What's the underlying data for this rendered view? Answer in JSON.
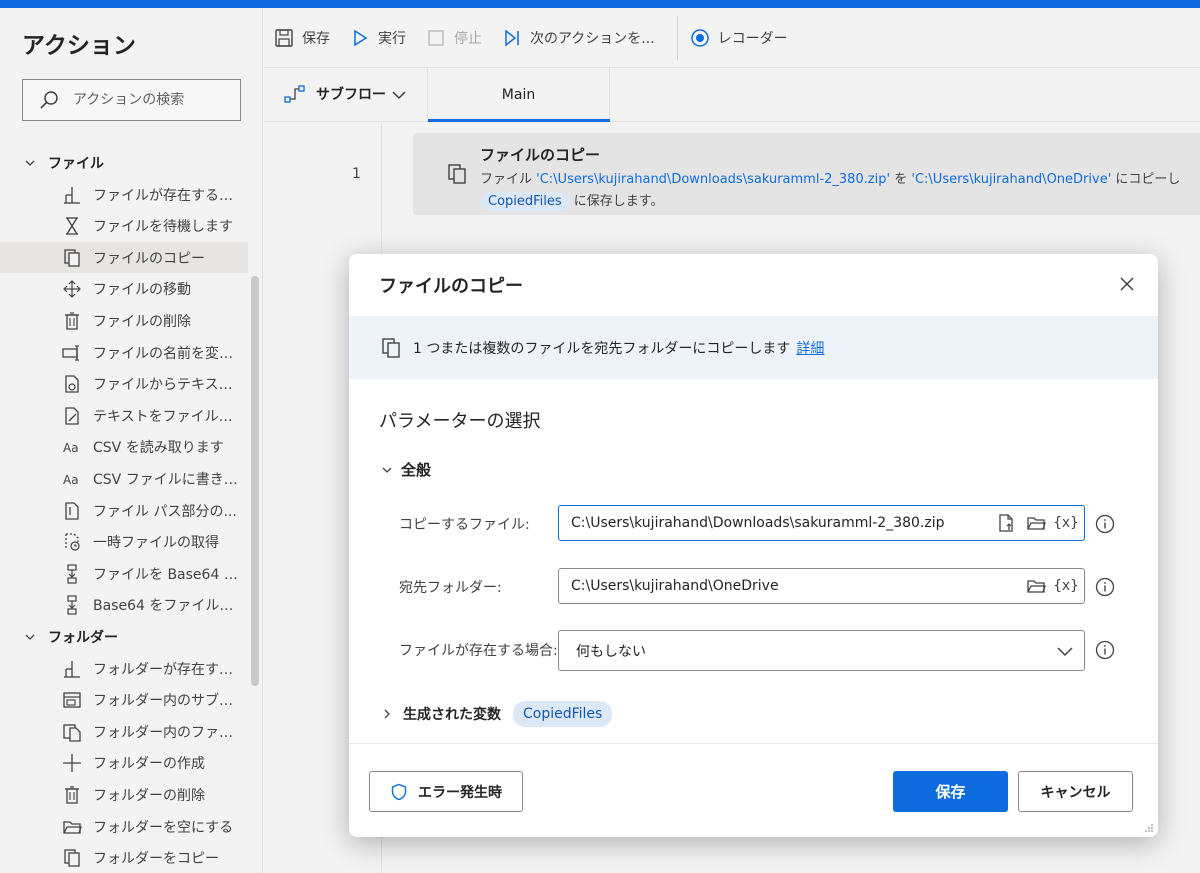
{
  "sidebar": {
    "title": "アクション",
    "search_placeholder": "アクションの検索",
    "groups": [
      {
        "label": "ファイル"
      },
      {
        "label": "フォルダー"
      }
    ],
    "file_items": [
      {
        "label": "ファイルが存在する場...",
        "icon": "branch-icon"
      },
      {
        "label": "ファイルを待機します",
        "icon": "hourglass-icon"
      },
      {
        "label": "ファイルのコピー",
        "icon": "copy-icon"
      },
      {
        "label": "ファイルの移動",
        "icon": "move-icon"
      },
      {
        "label": "ファイルの削除",
        "icon": "trash-icon"
      },
      {
        "label": "ファイルの名前を変更...",
        "icon": "rename-icon"
      },
      {
        "label": "ファイルからテキストを...",
        "icon": "file-read-icon"
      },
      {
        "label": "テキストをファイルに書...",
        "icon": "file-write-icon"
      },
      {
        "label": "CSV を読み取ります",
        "icon": "text-aa-icon"
      },
      {
        "label": "CSV ファイルに書き込...",
        "icon": "text-aa-icon"
      },
      {
        "label": "ファイル パス部分の...",
        "icon": "file-path-icon"
      },
      {
        "label": "一時ファイルの取得",
        "icon": "temp-file-icon"
      },
      {
        "label": "ファイルを Base64 に...",
        "icon": "convert-icon"
      },
      {
        "label": "Base64 をファイルに...",
        "icon": "convert-icon"
      }
    ],
    "folder_items": [
      {
        "label": "フォルダーが存在する...",
        "icon": "branch-icon"
      },
      {
        "label": "フォルダー内のサブフォ...",
        "icon": "subfolder-icon"
      },
      {
        "label": "フォルダー内のファイル...",
        "icon": "folder-files-icon"
      },
      {
        "label": "フォルダーの作成",
        "icon": "plus-icon"
      },
      {
        "label": "フォルダーの削除",
        "icon": "trash-icon"
      },
      {
        "label": "フォルダーを空にする",
        "icon": "folder-open-icon"
      },
      {
        "label": "フォルダーをコピー",
        "icon": "copy-icon"
      }
    ]
  },
  "toolbar": {
    "save": "保存",
    "run": "実行",
    "stop": "停止",
    "next_action": "次のアクションを...",
    "recorder": "レコーダー"
  },
  "subflow": {
    "label": "サブフロー",
    "tab_main": "Main"
  },
  "flow": {
    "line_number": "1",
    "action_title": "ファイルのコピー",
    "desc_prefix": "ファイル ",
    "source_path": "'C:\\Users\\kujirahand\\Downloads\\sakuramml-2_380.zip'",
    "desc_mid": " を ",
    "dest_path": "'C:\\Users\\kujirahand\\OneDrive'",
    "desc_suffix": " にコピーし",
    "var_name": "CopiedFiles",
    "desc_save": " に保存します。"
  },
  "dialog": {
    "title": "ファイルのコピー",
    "info_text": "1 つまたは複数のファイルを宛先フォルダーにコピーします",
    "info_link": "詳細",
    "section_title": "パラメーターの選択",
    "general_label": "全般",
    "fields": {
      "copy_file_label": "コピーするファイル:",
      "copy_file_value": "C:\\Users\\kujirahand\\Downloads\\sakuramml-2_380.zip",
      "dest_folder_label": "宛先フォルダー:",
      "dest_folder_value": "C:\\Users\\kujirahand\\OneDrive",
      "if_exists_label": "ファイルが存在する場合:",
      "if_exists_value": "何もしない",
      "var_button": "{x}"
    },
    "generated_vars_label": "生成された変数",
    "generated_var_chip": "CopiedFiles",
    "on_error": "エラー発生時",
    "save": "保存",
    "cancel": "キャンセル"
  },
  "colors": {
    "accent": "#0f6cde",
    "chip_bg": "#dde8f6",
    "info_bg": "#eef3fa"
  }
}
